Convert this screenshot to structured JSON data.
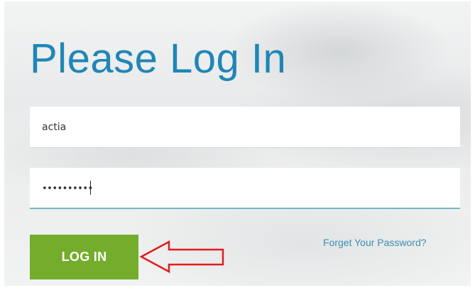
{
  "login": {
    "title": "Please Log In",
    "username_value": "actia",
    "password_value": "••••••••••",
    "login_button_label": "LOG IN",
    "forgot_password_label": "Forget Your Password?"
  },
  "annotation": {
    "arrow_icon": "left-arrow-outline",
    "arrow_color": "#e01c1c"
  },
  "colors": {
    "title": "#1f86b6",
    "button": "#74ad2b",
    "link": "#3d8fb5",
    "focus_border": "#74b6c9"
  }
}
